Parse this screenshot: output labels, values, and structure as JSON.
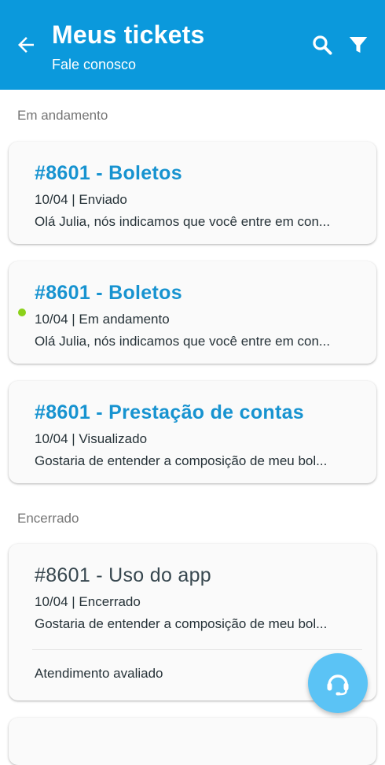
{
  "header": {
    "title": "Meus tickets",
    "subtitle": "Fale conosco"
  },
  "sections": {
    "open_label": "Em andamento",
    "closed_label": "Encerrado"
  },
  "tickets": [
    {
      "title": "#8601 - Boletos",
      "meta": "10/04 | Enviado",
      "preview": "Olá Julia, nós indicamos que você entre em con...",
      "unread": false
    },
    {
      "title": "#8601 - Boletos",
      "meta": "10/04 | Em andamento",
      "preview": "Olá Julia, nós indicamos que você entre em con...",
      "unread": true
    },
    {
      "title": "#8601 - Prestação de contas",
      "meta": "10/04 | Visualizado",
      "preview": "Gostaria de entender a composição de meu bol...",
      "unread": false
    }
  ],
  "closed_tickets": [
    {
      "title": "#8601 - Uso do app",
      "meta": "10/04 | Encerrado",
      "preview": "Gostaria de entender a composição de meu bol...",
      "footer": "Atendimento avaliado"
    }
  ],
  "colors": {
    "header": "#0b99dc",
    "title_link": "#1793d0",
    "unread_dot": "#8bd11a",
    "fab": "#5bc3f5"
  },
  "icons": {
    "back": "arrow-left-icon",
    "search": "search-icon",
    "filter": "filter-icon",
    "support": "headset-icon"
  }
}
